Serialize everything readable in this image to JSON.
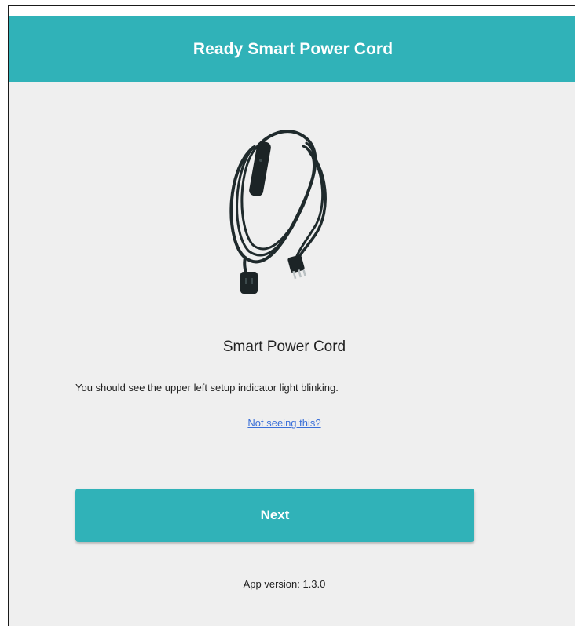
{
  "header": {
    "title": "Ready Smart Power Cord"
  },
  "product": {
    "name": "Smart Power Cord",
    "image_icon": "power-cord-image"
  },
  "instruction": {
    "text": "You should see the upper left setup indicator light blinking."
  },
  "help": {
    "link_label": "Not seeing this?"
  },
  "actions": {
    "next_label": "Next"
  },
  "footer": {
    "version_text": "App version: 1.3.0"
  },
  "colors": {
    "accent": "#30b2b8",
    "background": "#efefef",
    "link": "#3a6fd8"
  }
}
